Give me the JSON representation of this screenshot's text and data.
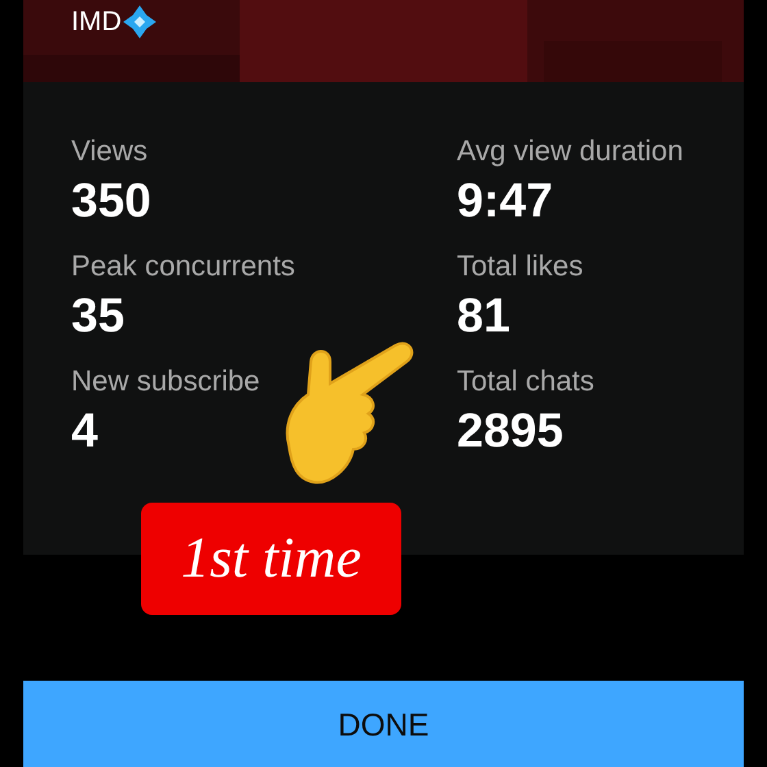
{
  "banner": {
    "brand": "IMD"
  },
  "stats": [
    {
      "label": "Views",
      "value": "350"
    },
    {
      "label": "Avg view duration",
      "value": "9:47"
    },
    {
      "label": "Peak concurrents",
      "value": "35"
    },
    {
      "label": "Total likes",
      "value": "81"
    },
    {
      "label": "New subscribe",
      "value": "4"
    },
    {
      "label": "Total chats",
      "value": "2895"
    }
  ],
  "sticker": {
    "text": "1st time"
  },
  "button": {
    "label": "DONE"
  }
}
